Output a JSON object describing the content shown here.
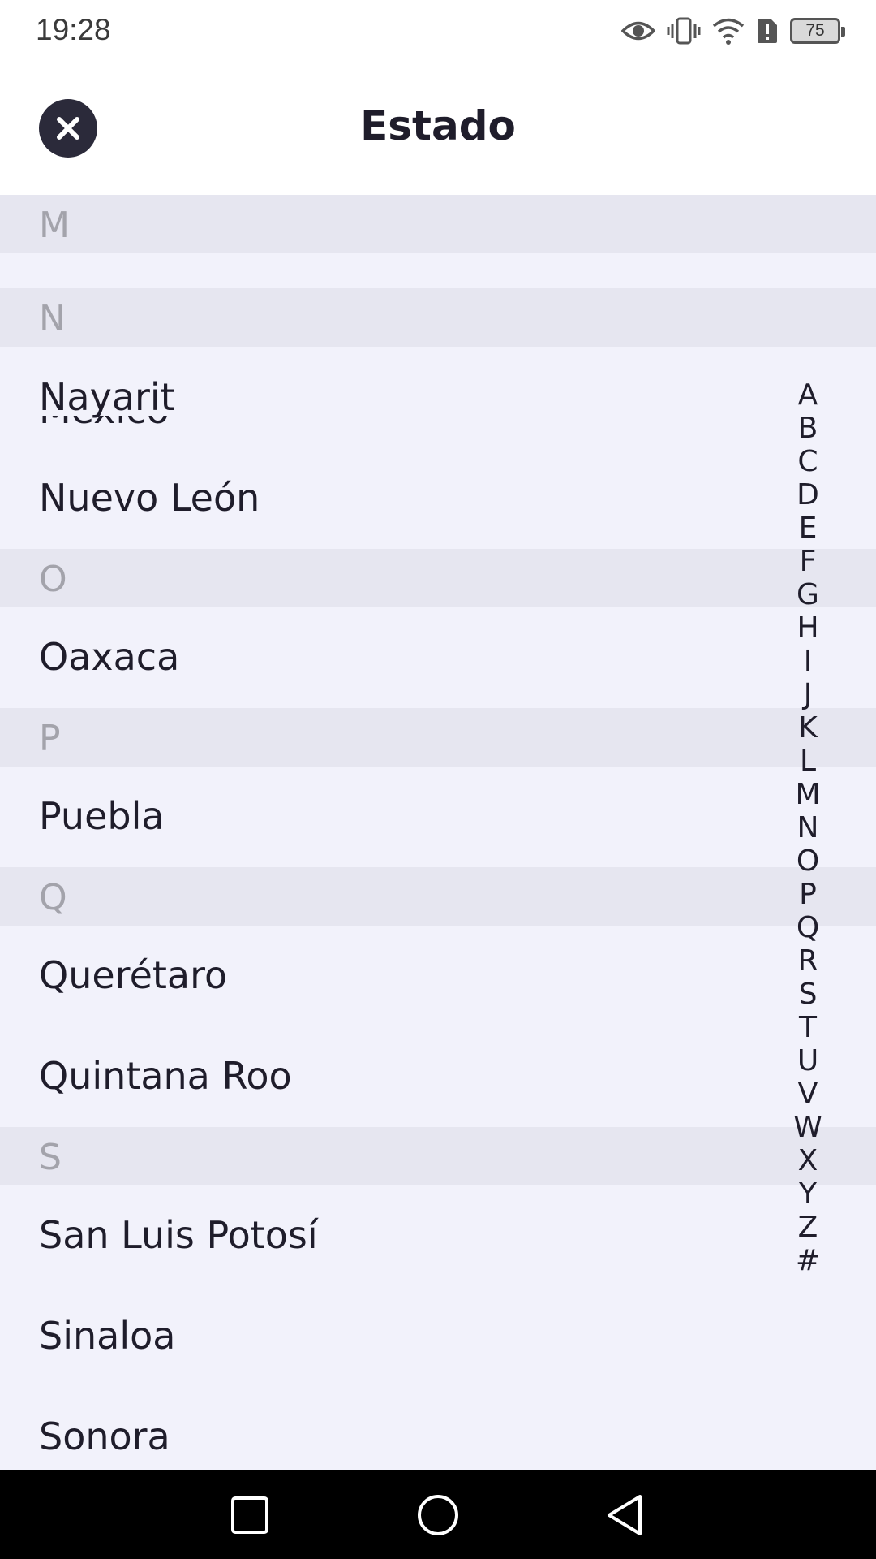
{
  "status_bar": {
    "time": "19:28",
    "battery": "75",
    "icons": [
      "eye-icon",
      "vibrate-icon",
      "wifi-icon",
      "alert-icon",
      "battery-icon"
    ]
  },
  "header": {
    "title": "Estado",
    "close_icon": "close-icon"
  },
  "list": {
    "clipped_item": "México",
    "sections": [
      {
        "letter": "M",
        "items": []
      },
      {
        "letter": "N",
        "items": [
          "Nayarit",
          "Nuevo León"
        ]
      },
      {
        "letter": "O",
        "items": [
          "Oaxaca"
        ]
      },
      {
        "letter": "P",
        "items": [
          "Puebla"
        ]
      },
      {
        "letter": "Q",
        "items": [
          "Querétaro",
          "Quintana Roo"
        ]
      },
      {
        "letter": "S",
        "items": [
          "San Luis Potosí",
          "Sinaloa",
          "Sonora"
        ]
      }
    ]
  },
  "index_letters": [
    "A",
    "B",
    "C",
    "D",
    "E",
    "F",
    "G",
    "H",
    "I",
    "J",
    "K",
    "L",
    "M",
    "N",
    "O",
    "P",
    "Q",
    "R",
    "S",
    "T",
    "U",
    "V",
    "W",
    "X",
    "Y",
    "Z",
    "#"
  ],
  "nav_bar": {
    "buttons": [
      "recents-square-icon",
      "home-circle-icon",
      "back-triangle-icon"
    ]
  },
  "colors": {
    "list_background": "#f2f2fb",
    "section_header_background": "#e6e6f0",
    "section_letter": "#a3a3ab",
    "text": "#1f1d2b",
    "close_button": "#2b2a3a"
  }
}
